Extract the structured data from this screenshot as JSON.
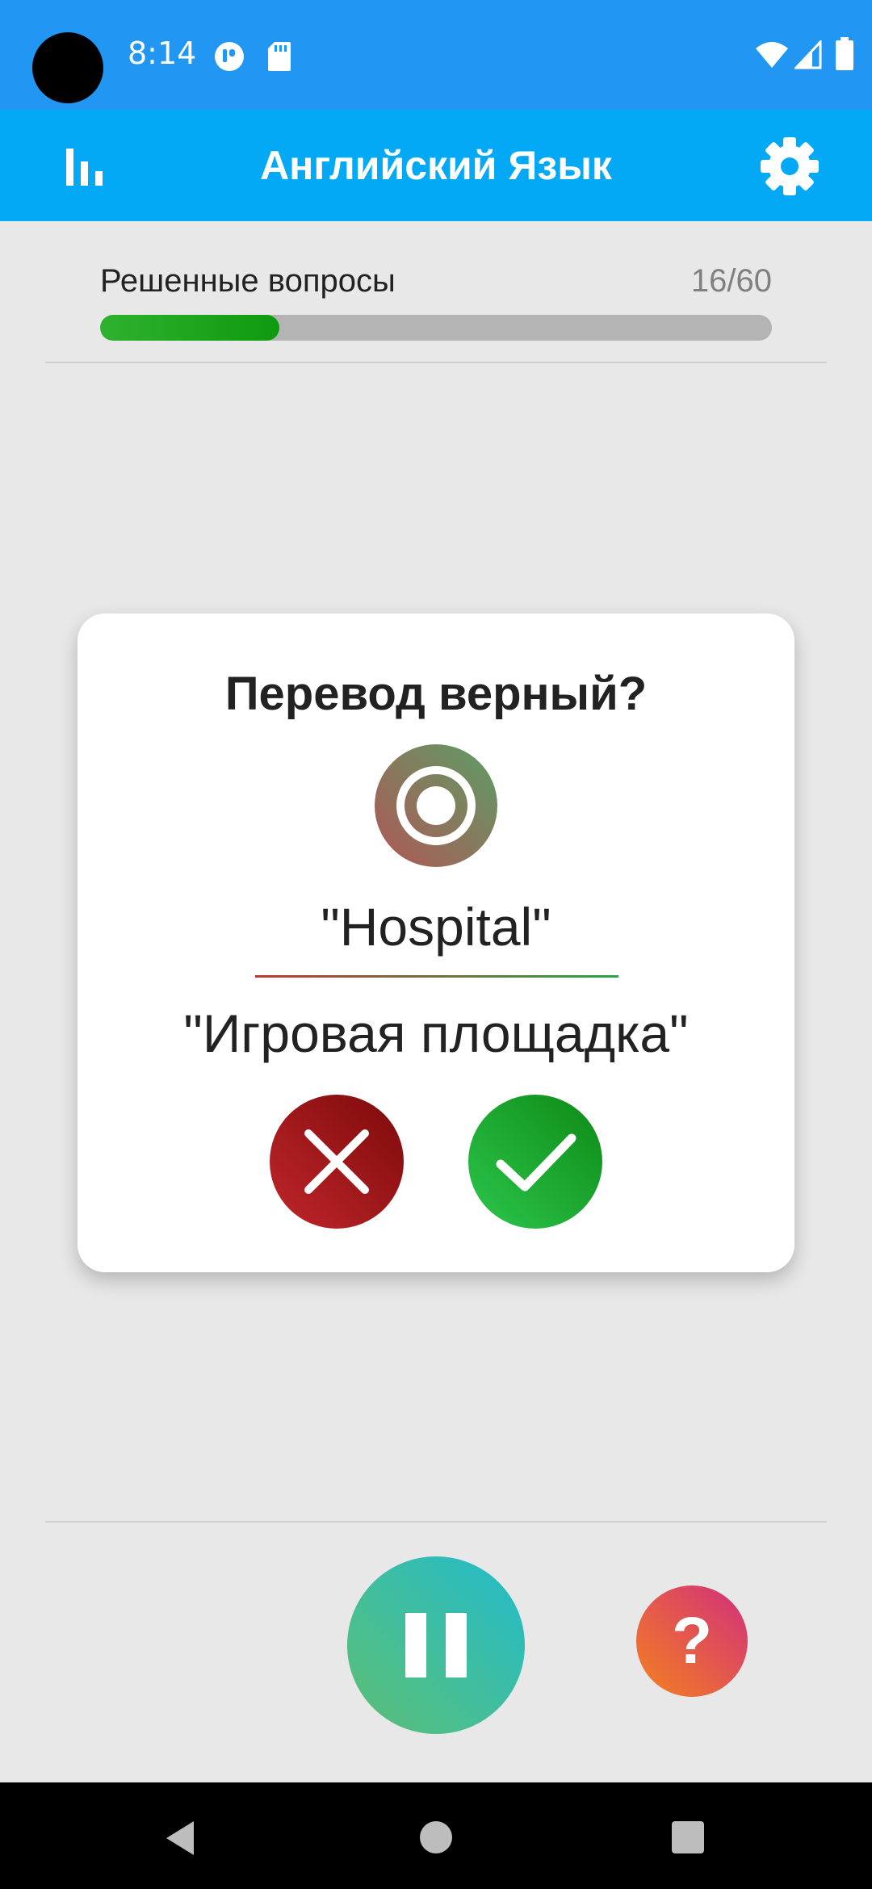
{
  "status_bar": {
    "time": "8:14",
    "icons": [
      "notification-app-icon",
      "sd-card-icon",
      "wifi-icon",
      "cell-signal-icon",
      "battery-icon"
    ]
  },
  "app_bar": {
    "title": "Английский Язык",
    "left_icon": "stats-icon",
    "right_icon": "gear-icon"
  },
  "progress": {
    "label": "Решенные вопросы",
    "count": "16/60",
    "solved": 16,
    "total": 60
  },
  "card": {
    "question": "Перевод верный?",
    "icon": "target-icon",
    "word": "\"Hospital\"",
    "translation": "\"Игровая площадка\"",
    "no_icon": "close-icon",
    "yes_icon": "check-icon"
  },
  "controls": {
    "pause_icon": "pause-icon",
    "help_label": "?"
  },
  "nav": {
    "icons": [
      "back-icon",
      "home-icon",
      "recents-icon"
    ]
  },
  "colors": {
    "status_bar": "#2196f3",
    "app_bar": "#03a9f4",
    "background": "#e8e8e8",
    "progress_fill": "#1aa61a",
    "no_button": "#a51a1f",
    "yes_button": "#1fae33"
  }
}
